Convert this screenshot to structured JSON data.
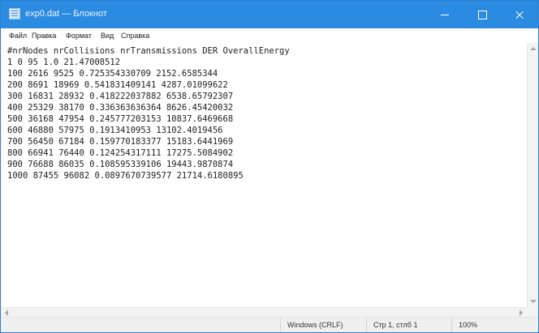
{
  "window": {
    "title": "exp0.dat — Блокнот"
  },
  "menu": {
    "items": [
      "Файл",
      "Правка",
      "Формат",
      "Вид",
      "Справка"
    ]
  },
  "editor": {
    "lines": [
      "#nrNodes nrCollisions nrTransmissions DER OverallEnergy",
      "1 0 95 1.0 21.47008512",
      "100 2616 9525 0.725354330709 2152.6585344",
      "200 8691 18969 0.541831409141 4287.01099622",
      "300 16831 28932 0.418222037882 6538.65792307",
      "400 25329 38170 0.336363636364 8626.45420032",
      "500 36168 47954 0.245777203153 10837.6469668",
      "600 46880 57975 0.1913410953 13102.4019456",
      "700 56450 67184 0.159770183377 15183.6441969",
      "800 66941 76440 0.124254317111 17275.5084902",
      "900 76688 86035 0.108595339106 19443.9870874",
      "1000 87455 96082 0.0897670739577 21714.6180895"
    ]
  },
  "status": {
    "encoding": "Windows (CRLF)",
    "position": "Стр 1, стлб 1",
    "zoom": "100%"
  },
  "icons": {
    "app": "notepad-icon",
    "minimize": "minimize-icon",
    "maximize": "maximize-icon",
    "close": "close-icon"
  },
  "colors": {
    "titlebar": "#2b8be0",
    "text": "#1e1e1e"
  }
}
